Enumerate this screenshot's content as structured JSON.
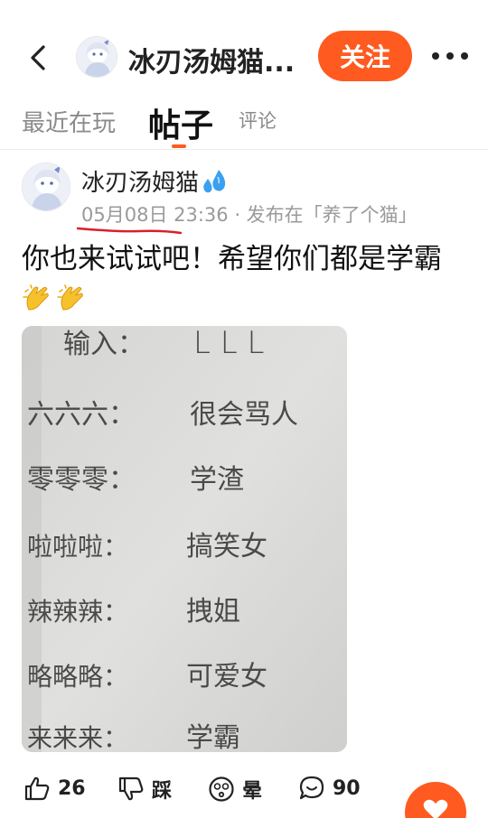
{
  "header": {
    "title": "冰刃汤姆猫...",
    "follow_label": "关注"
  },
  "tabs": [
    {
      "label": "最近在玩"
    },
    {
      "label": "帖子"
    },
    {
      "label": "评论"
    }
  ],
  "post": {
    "author": "冰刃汤姆猫",
    "date": "05月08日",
    "time_and_source": " 23:36 · 发布在「养了个猫」",
    "text": "你也来试试吧！希望你们都是学霸",
    "image": {
      "header": "输入：",
      "header_value": "L L L",
      "rows": [
        {
          "input": "六六六：",
          "output": "很会骂人"
        },
        {
          "input": "零零零：",
          "output": "学渣"
        },
        {
          "input": "啦啦啦：",
          "output": "搞笑女"
        },
        {
          "input": "辣辣辣：",
          "output": "拽姐"
        },
        {
          "input": "略略略：",
          "output": "可爱女"
        },
        {
          "input": "来来来：",
          "output": "学霸"
        }
      ]
    }
  },
  "actions": {
    "like_count": "26",
    "dislike_label": "踩",
    "dizzy_label": "晕",
    "comment_count": "90"
  },
  "colors": {
    "accent": "#ff5a1f",
    "meta_gray": "#9a9a9a",
    "underline_red": "#d8202a"
  }
}
